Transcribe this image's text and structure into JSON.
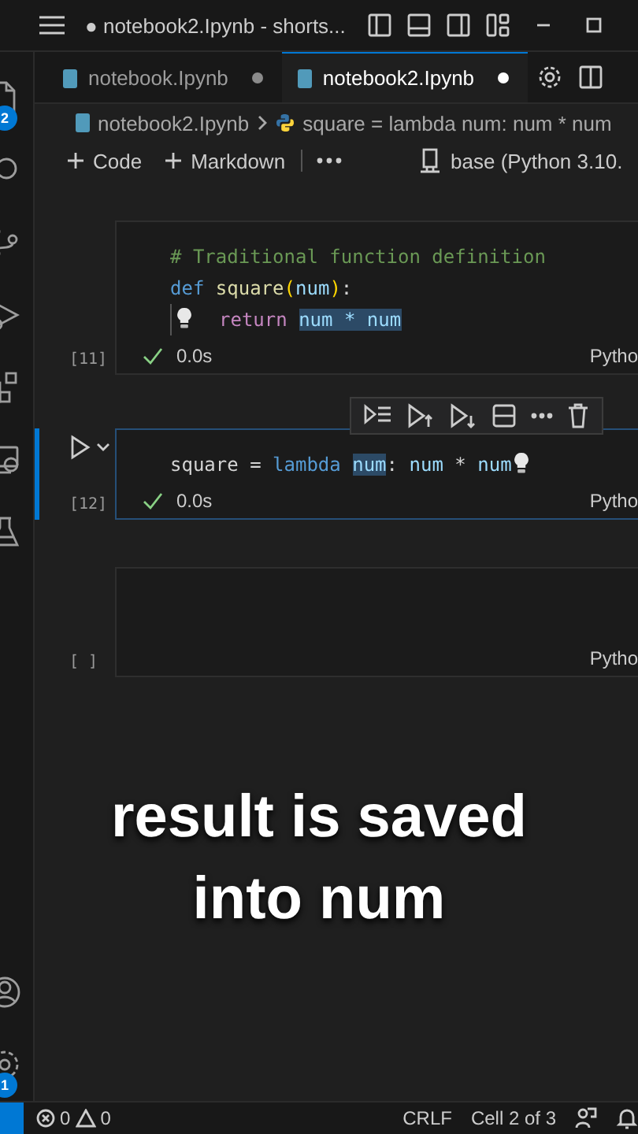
{
  "title_bar": {
    "title": "● notebook2.Ipynb - shorts..."
  },
  "activity_bar": {
    "top": [
      {
        "kind": "files",
        "badge": "2"
      },
      {
        "kind": "search"
      },
      {
        "kind": "source-control"
      },
      {
        "kind": "run"
      },
      {
        "kind": "extensions"
      },
      {
        "kind": "remote"
      },
      {
        "kind": "flask"
      }
    ],
    "bottom": [
      {
        "kind": "account"
      },
      {
        "kind": "gear",
        "badge": "1"
      }
    ]
  },
  "tabs": [
    {
      "label": "notebook.Ipynb",
      "selected": false,
      "dirty": true
    },
    {
      "label": "notebook2.Ipynb",
      "selected": true,
      "dirty": true
    }
  ],
  "breadcrumb": [
    "notebook2.Ipynb",
    "square = lambda num: num * num"
  ],
  "toolbar": {
    "items": [
      "Code",
      "Markdown"
    ],
    "kernel": "base (Python 3.10."
  },
  "cells": [
    {
      "execution": "[11]",
      "status": "0.0s",
      "succeeded": true,
      "language": "Pytho",
      "selected": false,
      "lines": [
        [
          {
            "kind": "comment",
            "text": "# Traditional function definition"
          }
        ],
        [
          {
            "kind": "keyword",
            "text": "def "
          },
          {
            "kind": "function",
            "text": "square"
          },
          {
            "kind": "bracket",
            "text": "("
          },
          {
            "kind": "variable",
            "text": "num"
          },
          {
            "kind": "bracket",
            "text": ")"
          },
          {
            "kind": "plain",
            "text": ":"
          }
        ],
        [
          {
            "kind": "bulb"
          },
          {
            "kind": "control",
            "text": "return "
          },
          {
            "kind": "match",
            "text": "num * num"
          }
        ]
      ]
    },
    {
      "execution": "[12]",
      "status": "0.0s",
      "succeeded": true,
      "language": "Pytho",
      "selected": true,
      "lines": [
        [
          {
            "kind": "plain",
            "text": "square = "
          },
          {
            "kind": "keyword",
            "text": "lambda "
          },
          {
            "kind": "match",
            "text": "num"
          },
          {
            "kind": "plain",
            "text": ": "
          },
          {
            "kind": "variable",
            "text": "num"
          },
          {
            "kind": "plain",
            "text": " * "
          },
          {
            "kind": "variable",
            "text": "num"
          },
          {
            "kind": "bulb"
          }
        ]
      ]
    },
    {
      "execution": "[ ]",
      "language": "Pytho",
      "selected": false
    }
  ],
  "caption": [
    "result is saved",
    "into num"
  ],
  "status_bar": {
    "errors": "0",
    "warnings": "0",
    "items": [
      "CRLF",
      "Cell 2 of 3"
    ]
  }
}
